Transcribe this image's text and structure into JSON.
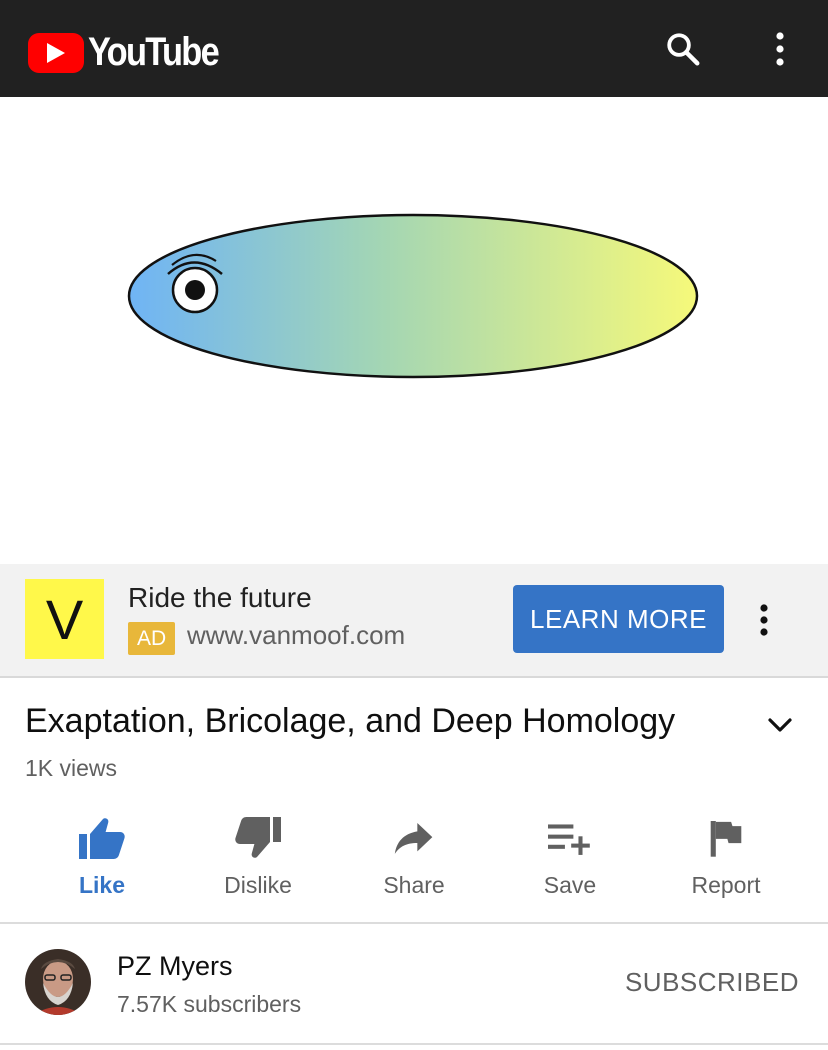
{
  "header": {
    "logo_text": "YouTube",
    "search_icon": "search-icon",
    "menu_icon": "more-vert-icon"
  },
  "player": {
    "illustration": "fish-drawing"
  },
  "ad": {
    "logo_letter": "V",
    "title": "Ride the future",
    "badge": "AD",
    "url": "www.vanmoof.com",
    "cta": "LEARN MORE",
    "menu_icon": "more-vert-icon",
    "colors": {
      "logo_bg": "#fff84a",
      "badge_bg": "#e8b73a",
      "cta_bg": "#3574c6"
    }
  },
  "video": {
    "title": "Exaptation, Bricolage, and Deep Homology",
    "views": "1K views",
    "expand_icon": "chevron-down-icon"
  },
  "actions": [
    {
      "label": "Like",
      "icon": "thumb-up-icon",
      "active": true
    },
    {
      "label": "Dislike",
      "icon": "thumb-down-icon",
      "active": false
    },
    {
      "label": "Share",
      "icon": "share-icon",
      "active": false
    },
    {
      "label": "Save",
      "icon": "playlist-add-icon",
      "active": false
    },
    {
      "label": "Report",
      "icon": "flag-icon",
      "active": false
    }
  ],
  "channel": {
    "name": "PZ Myers",
    "subscribers": "7.57K subscribers",
    "subscribe_state": "SUBSCRIBED"
  }
}
